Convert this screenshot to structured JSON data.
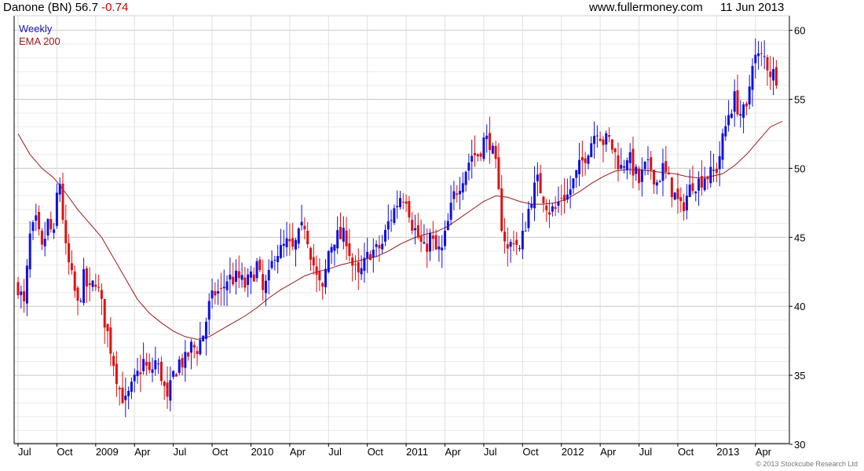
{
  "header": {
    "stock": "Danone (BN)",
    "price": "56.7",
    "change": "-0.74",
    "site": "www.fullermoney.com",
    "date": "11 Jun 2013"
  },
  "legend": {
    "weekly": "Weekly",
    "ema": "EMA 200"
  },
  "copyright": "© 2013 Stockcube Research Ltd",
  "colors": {
    "up": "#1010e0",
    "down": "#e01010",
    "ema": "#9a1a1a",
    "grid": "#cfcfcf",
    "axis": "#888888"
  },
  "chart_data": {
    "type": "candlestick",
    "ylim": [
      30,
      61
    ],
    "yticks": [
      30,
      35,
      40,
      45,
      50,
      55,
      60
    ],
    "xlim": [
      0,
      256
    ],
    "xticks": [
      {
        "label": "Jul",
        "week": 0
      },
      {
        "label": "Oct",
        "week": 13
      },
      {
        "label": "2009",
        "week": 26
      },
      {
        "label": "Apr",
        "week": 39
      },
      {
        "label": "Jul",
        "week": 52
      },
      {
        "label": "Oct",
        "week": 65
      },
      {
        "label": "2010",
        "week": 78
      },
      {
        "label": "Apr",
        "week": 91
      },
      {
        "label": "Jul",
        "week": 104
      },
      {
        "label": "Oct",
        "week": 117
      },
      {
        "label": "2011",
        "week": 130
      },
      {
        "label": "Apr",
        "week": 143
      },
      {
        "label": "Jul",
        "week": 156
      },
      {
        "label": "Oct",
        "week": 169
      },
      {
        "label": "2012",
        "week": 182
      },
      {
        "label": "Apr",
        "week": 195
      },
      {
        "label": "Jul",
        "week": 208
      },
      {
        "label": "Oct",
        "week": 221
      },
      {
        "label": "2013",
        "week": 234
      },
      {
        "label": "Apr",
        "week": 247
      }
    ],
    "close_path": [
      [
        0,
        41.5
      ],
      [
        2,
        40
      ],
      [
        4,
        45
      ],
      [
        6,
        46
      ],
      [
        8,
        44
      ],
      [
        10,
        46
      ],
      [
        12,
        45
      ],
      [
        13,
        48
      ],
      [
        14,
        49
      ],
      [
        16,
        44
      ],
      [
        18,
        42
      ],
      [
        20,
        40
      ],
      [
        22,
        42
      ],
      [
        24,
        41
      ],
      [
        26,
        42
      ],
      [
        28,
        40
      ],
      [
        30,
        38
      ],
      [
        32,
        36
      ],
      [
        34,
        34
      ],
      [
        36,
        33
      ],
      [
        38,
        34
      ],
      [
        40,
        35
      ],
      [
        42,
        36
      ],
      [
        44,
        35
      ],
      [
        46,
        36
      ],
      [
        48,
        35
      ],
      [
        50,
        33
      ],
      [
        52,
        35
      ],
      [
        54,
        36
      ],
      [
        56,
        36
      ],
      [
        58,
        37
      ],
      [
        60,
        37
      ],
      [
        62,
        38
      ],
      [
        64,
        40
      ],
      [
        66,
        41
      ],
      [
        68,
        41
      ],
      [
        70,
        42
      ],
      [
        72,
        42
      ],
      [
        74,
        42
      ],
      [
        76,
        41.5
      ],
      [
        78,
        42
      ],
      [
        80,
        43
      ],
      [
        82,
        41
      ],
      [
        84,
        42
      ],
      [
        86,
        44
      ],
      [
        88,
        44
      ],
      [
        90,
        44.5
      ],
      [
        92,
        44
      ],
      [
        94,
        45
      ],
      [
        96,
        46
      ],
      [
        98,
        44
      ],
      [
        100,
        42
      ],
      [
        102,
        41
      ],
      [
        104,
        44
      ],
      [
        106,
        45
      ],
      [
        108,
        45
      ],
      [
        110,
        45
      ],
      [
        112,
        43
      ],
      [
        114,
        42
      ],
      [
        116,
        43
      ],
      [
        118,
        44
      ],
      [
        120,
        44
      ],
      [
        122,
        44.5
      ],
      [
        124,
        46
      ],
      [
        126,
        47
      ],
      [
        128,
        48
      ],
      [
        130,
        48
      ],
      [
        132,
        46
      ],
      [
        134,
        45
      ],
      [
        136,
        44
      ],
      [
        138,
        45
      ],
      [
        140,
        44
      ],
      [
        142,
        44
      ],
      [
        144,
        46
      ],
      [
        146,
        48
      ],
      [
        148,
        49
      ],
      [
        150,
        50
      ],
      [
        152,
        51
      ],
      [
        154,
        51
      ],
      [
        156,
        52
      ],
      [
        158,
        52
      ],
      [
        160,
        50
      ],
      [
        162,
        46
      ],
      [
        164,
        44
      ],
      [
        166,
        45
      ],
      [
        168,
        44
      ],
      [
        170,
        46
      ],
      [
        172,
        48
      ],
      [
        174,
        49
      ],
      [
        176,
        48
      ],
      [
        178,
        47
      ],
      [
        180,
        47
      ],
      [
        182,
        48
      ],
      [
        184,
        48
      ],
      [
        186,
        49
      ],
      [
        188,
        50
      ],
      [
        190,
        51
      ],
      [
        192,
        52
      ],
      [
        194,
        53
      ],
      [
        196,
        52
      ],
      [
        198,
        52
      ],
      [
        200,
        51
      ],
      [
        202,
        50
      ],
      [
        204,
        51
      ],
      [
        206,
        50
      ],
      [
        208,
        49
      ],
      [
        210,
        50
      ],
      [
        212,
        50
      ],
      [
        214,
        49
      ],
      [
        216,
        50
      ],
      [
        218,
        49
      ],
      [
        220,
        48
      ],
      [
        222,
        47
      ],
      [
        224,
        48
      ],
      [
        226,
        49
      ],
      [
        228,
        49
      ],
      [
        230,
        49.5
      ],
      [
        232,
        49.5
      ],
      [
        234,
        50
      ],
      [
        236,
        52
      ],
      [
        238,
        54
      ],
      [
        240,
        55
      ],
      [
        242,
        54
      ],
      [
        244,
        54
      ],
      [
        245,
        56
      ],
      [
        246,
        58
      ],
      [
        248,
        58
      ],
      [
        250,
        58
      ],
      [
        252,
        57
      ],
      [
        254,
        56.7
      ]
    ],
    "ema_path": [
      [
        0,
        52.5
      ],
      [
        4,
        51
      ],
      [
        8,
        50
      ],
      [
        12,
        49.3
      ],
      [
        16,
        48.2
      ],
      [
        20,
        47
      ],
      [
        24,
        46
      ],
      [
        28,
        45
      ],
      [
        32,
        43.5
      ],
      [
        36,
        42
      ],
      [
        40,
        40.5
      ],
      [
        44,
        39.5
      ],
      [
        48,
        38.8
      ],
      [
        52,
        38.2
      ],
      [
        56,
        37.8
      ],
      [
        60,
        37.6
      ],
      [
        64,
        37.8
      ],
      [
        68,
        38.3
      ],
      [
        72,
        38.8
      ],
      [
        76,
        39.3
      ],
      [
        80,
        39.9
      ],
      [
        84,
        40.6
      ],
      [
        88,
        41.2
      ],
      [
        92,
        41.7
      ],
      [
        96,
        42.2
      ],
      [
        100,
        42.5
      ],
      [
        104,
        42.7
      ],
      [
        108,
        43
      ],
      [
        112,
        43.2
      ],
      [
        116,
        43.4
      ],
      [
        120,
        43.6
      ],
      [
        124,
        44
      ],
      [
        128,
        44.5
      ],
      [
        132,
        44.9
      ],
      [
        136,
        45.2
      ],
      [
        140,
        45.4
      ],
      [
        144,
        45.8
      ],
      [
        148,
        46.4
      ],
      [
        152,
        47
      ],
      [
        156,
        47.6
      ],
      [
        160,
        48
      ],
      [
        164,
        47.9
      ],
      [
        168,
        47.6
      ],
      [
        172,
        47.4
      ],
      [
        176,
        47.4
      ],
      [
        180,
        47.5
      ],
      [
        184,
        47.8
      ],
      [
        188,
        48.3
      ],
      [
        192,
        48.9
      ],
      [
        196,
        49.4
      ],
      [
        200,
        49.8
      ],
      [
        204,
        49.9
      ],
      [
        208,
        49.9
      ],
      [
        212,
        49.8
      ],
      [
        216,
        49.7
      ],
      [
        220,
        49.6
      ],
      [
        224,
        49.4
      ],
      [
        228,
        49.3
      ],
      [
        232,
        49.4
      ],
      [
        236,
        49.6
      ],
      [
        240,
        50.2
      ],
      [
        244,
        51
      ],
      [
        248,
        52
      ],
      [
        252,
        53
      ],
      [
        256,
        53.4
      ]
    ]
  }
}
